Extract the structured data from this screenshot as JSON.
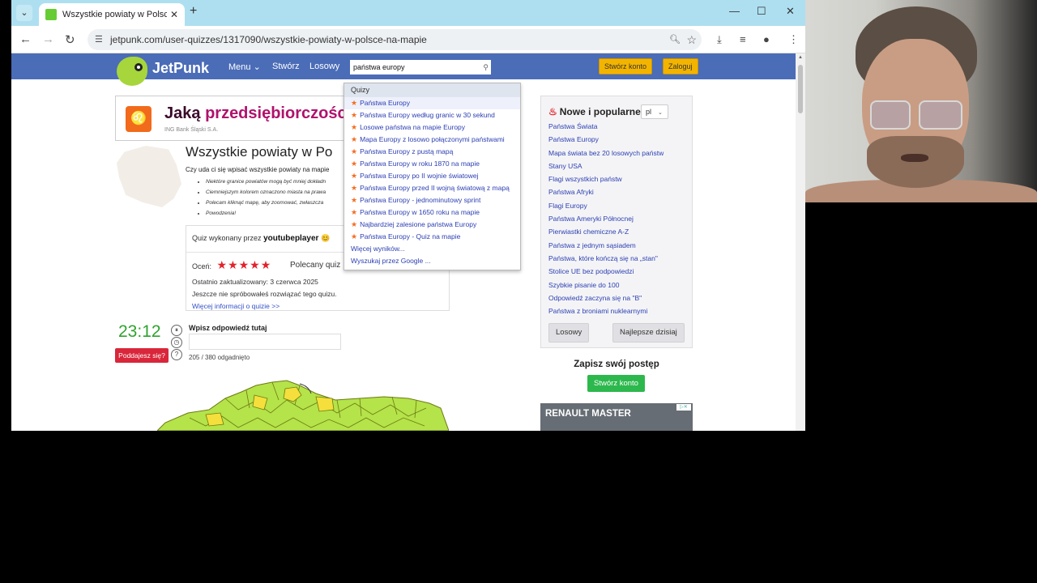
{
  "browser": {
    "tab_title": "Wszystkie powiaty w Polsce na",
    "url": "jetpunk.com/user-quizzes/1317090/wszystkie-powiaty-w-polsce-na-mapie",
    "icons": [
      "tab-dropdown-icon",
      "close-icon",
      "plus-icon",
      "minimize-icon",
      "maximize-icon",
      "back-icon",
      "forward-icon",
      "reload-icon",
      "tune-icon",
      "zoom-icon",
      "star-icon",
      "download-icon",
      "media-icon",
      "profile-icon",
      "menu-icon"
    ]
  },
  "site": {
    "logo": "JetPunk",
    "nav": {
      "menu": "Menu",
      "create": "Stwórz",
      "random": "Losowy"
    },
    "search_value": "państwa europy",
    "create_account": "Stwórz konto",
    "login": "Zaloguj"
  },
  "ad_banner": {
    "text_dark": "Jaką",
    "text_pink": "przedsiębiorczościa",
    "sub": "ING Bank Śląski S.A."
  },
  "quiz": {
    "title": "Wszystkie powiaty w Po",
    "description": "Czy uda ci się wpisać wszystkie powiaty na mapie",
    "bullets": [
      "Niektóre granice powiatów mogą być mniej dokładn",
      "Ciemniejszym kolorem oznaczono miasta na prawa",
      "Polecam kliknąć mapę, aby zoomować, zwłaszcza",
      "Powodzenia!"
    ],
    "author_prefix": "Quiz wykonany przez",
    "author": "youtubeplayer",
    "author_emoji": "😊",
    "rating_label": "Oceń:",
    "stars": "★★★★★",
    "recommended": "Polecany quiz",
    "updated": "Ostatnio zaktualizowany: 3 czerwca 2025",
    "not_tried": "Jeszcze nie spróbowałeś rozwiązać tego quizu.",
    "more_info": "Więcej informacji o quizie >>",
    "timer": "23:12",
    "give_up": "Poddajesz się?",
    "answer_label": "Wpisz odpowiedź tutaj",
    "answer_value": "",
    "count": "205 / 380 odgadnięto"
  },
  "suggestions": {
    "section": "Quizy",
    "items": [
      "Państwa Europy",
      "Państwa Europy według granic w 30 sekund",
      "Losowe państwa na mapie Europy",
      "Mapa Europy z losowo połączonymi państwami",
      "Państwa Europy z pustą mapą",
      "Państwa Europy w roku 1870 na mapie",
      "Państwa Europy po II wojnie światowej",
      "Państwa Europy przed II wojną światową z mapą",
      "Państwa Europy - jednominutowy sprint",
      "Państwa Europy w 1650 roku na mapie",
      "Najbardziej zalesione państwa Europy",
      "Państwa Europy - Quiz na mapie"
    ],
    "more": "Więcej wyników...",
    "google": "Wyszukaj przez Google ..."
  },
  "popular": {
    "title": "Nowe i popularne",
    "lang": "pl",
    "items": [
      "Państwa Świata",
      "Państwa Europy",
      "Mapa świata bez 20 losowych państw",
      "Stany USA",
      "Flagi wszystkich państw",
      "Państwa Afryki",
      "Flagi Europy",
      "Państwa Ameryki Północnej",
      "Pierwiastki chemiczne A-Z",
      "Państwa z jednym sąsiadem",
      "Państwa, które kończą się na „stan\"",
      "Stolice UE bez podpowiedzi",
      "Szybkie pisanie do 100",
      "Odpowiedź zaczyna się na \"B\"",
      "Państwa z broniami nuklearnymi"
    ],
    "random_btn": "Losowy",
    "best_btn": "Najlepsze dzisiaj"
  },
  "sidebar": {
    "save_progress": "Zapisz swój postęp",
    "create_account": "Stwórz konto",
    "renault": "RENAULT MASTER"
  }
}
